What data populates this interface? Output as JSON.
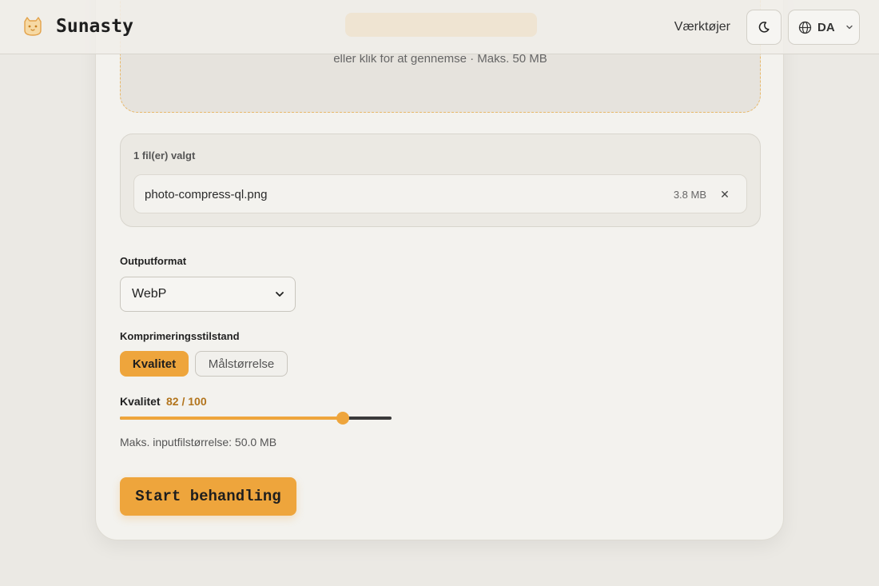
{
  "header": {
    "brand": "Sunasty",
    "nav_tools": "Værktøjer",
    "language": "DA"
  },
  "dropzone": {
    "hint": "eller klik for at gennemse · Maks. 50 MB"
  },
  "files": {
    "count_label": "1 fil(er) valgt",
    "items": [
      {
        "name": "photo-compress-ql.png",
        "size": "3.8 MB"
      }
    ],
    "remove_glyph": "✕"
  },
  "output_format": {
    "label": "Outputformat",
    "selected": "WebP"
  },
  "compression_mode": {
    "label": "Komprimeringsstilstand",
    "options": [
      "Kvalitet",
      "Målstørrelse"
    ],
    "active": "Kvalitet"
  },
  "quality": {
    "label": "Kvalitet",
    "value_text": "82 / 100",
    "value": 82,
    "max": 100
  },
  "max_input_size": "Maks. inputfilstørrelse: 50.0 MB",
  "start_button": "Start behandling",
  "colors": {
    "accent": "#eea53c",
    "background": "#ebe9e4"
  }
}
